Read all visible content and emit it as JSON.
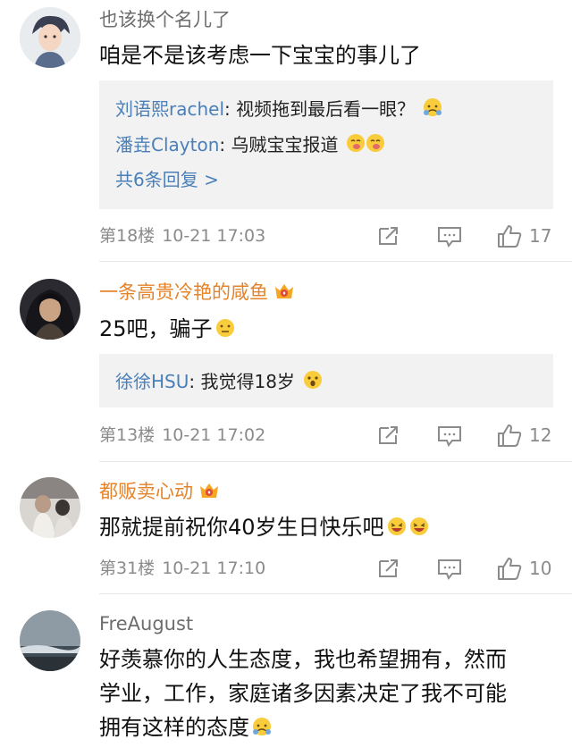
{
  "comments": [
    {
      "username": "也该换个名儿了",
      "text": "咱是不是该考虑一下宝宝的事儿了",
      "replies": [
        {
          "name": "刘语熙rachel",
          "text": ": 视频拖到最后看一眼？",
          "emoji": "shy-emoji"
        },
        {
          "name": "潘垚Clayton",
          "text": ": 乌贼宝宝报道",
          "emoji": "drooling-emoji"
        }
      ],
      "more_replies": "共6条回复 >",
      "floor": "第18楼",
      "time": "10-21 17:03",
      "likes": "17"
    },
    {
      "username": "一条高贵冷艳的咸鱼",
      "text": "25吧，骗子",
      "text_emoji": "thinking-emoji",
      "replies": [
        {
          "name": "徐徐HSU",
          "text": ": 我觉得18岁",
          "emoji": "shocked-emoji"
        }
      ],
      "floor": "第13楼",
      "time": "10-21 17:02",
      "likes": "12"
    },
    {
      "username": "都贩卖心动",
      "text": "那就提前祝你40岁生日快乐吧",
      "text_emoji": "laughing-emoji",
      "floor": "第31楼",
      "time": "10-21 17:10",
      "likes": "10"
    },
    {
      "username": "FreAugust",
      "text_lines": [
        "好羡慕你的人生态度，我也希望拥有，然而",
        "学业，工作，家庭诸多因素决定了我不可能",
        "拥有这样的态度"
      ],
      "text_emoji": "shy-emoji"
    }
  ],
  "colors": {
    "reply_name": "#4a7fb8",
    "vip_name": "#e5832a",
    "meta": "#8b8b8b",
    "reply_bg": "#f2f2f2"
  }
}
